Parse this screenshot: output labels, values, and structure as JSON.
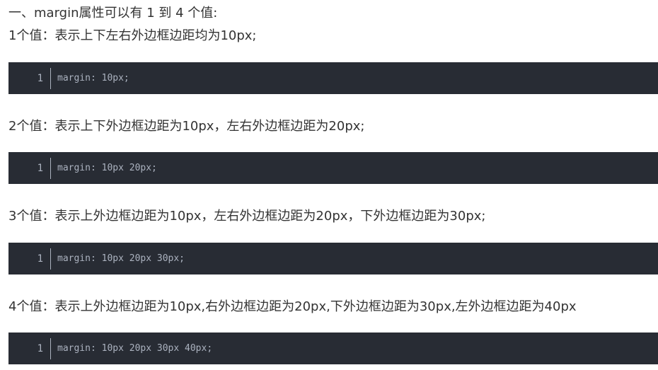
{
  "intro": {
    "heading": "一、margin属性可以有 1 到 4 个值:",
    "one_value_desc": "1个值：表示上下左右外边框边距均为10px;"
  },
  "examples": [
    {
      "line_number": "1",
      "code": "margin: 10px;"
    },
    {
      "description": "2个值：表示上下外边框边距为10px，左右外边框边距为20px;",
      "line_number": "1",
      "code": "margin: 10px 20px;"
    },
    {
      "description": "3个值：表示上外边框边距为10px，左右外边框边距为20px，下外边框边距为30px;",
      "line_number": "1",
      "code": "margin: 10px 20px 30px;"
    },
    {
      "description": "4个值：表示上外边框边距为10px,右外边框边距为20px,下外边框边距为30px,左外边框边距为40px",
      "line_number": "1",
      "code": "margin: 10px 20px 30px 40px;"
    }
  ]
}
